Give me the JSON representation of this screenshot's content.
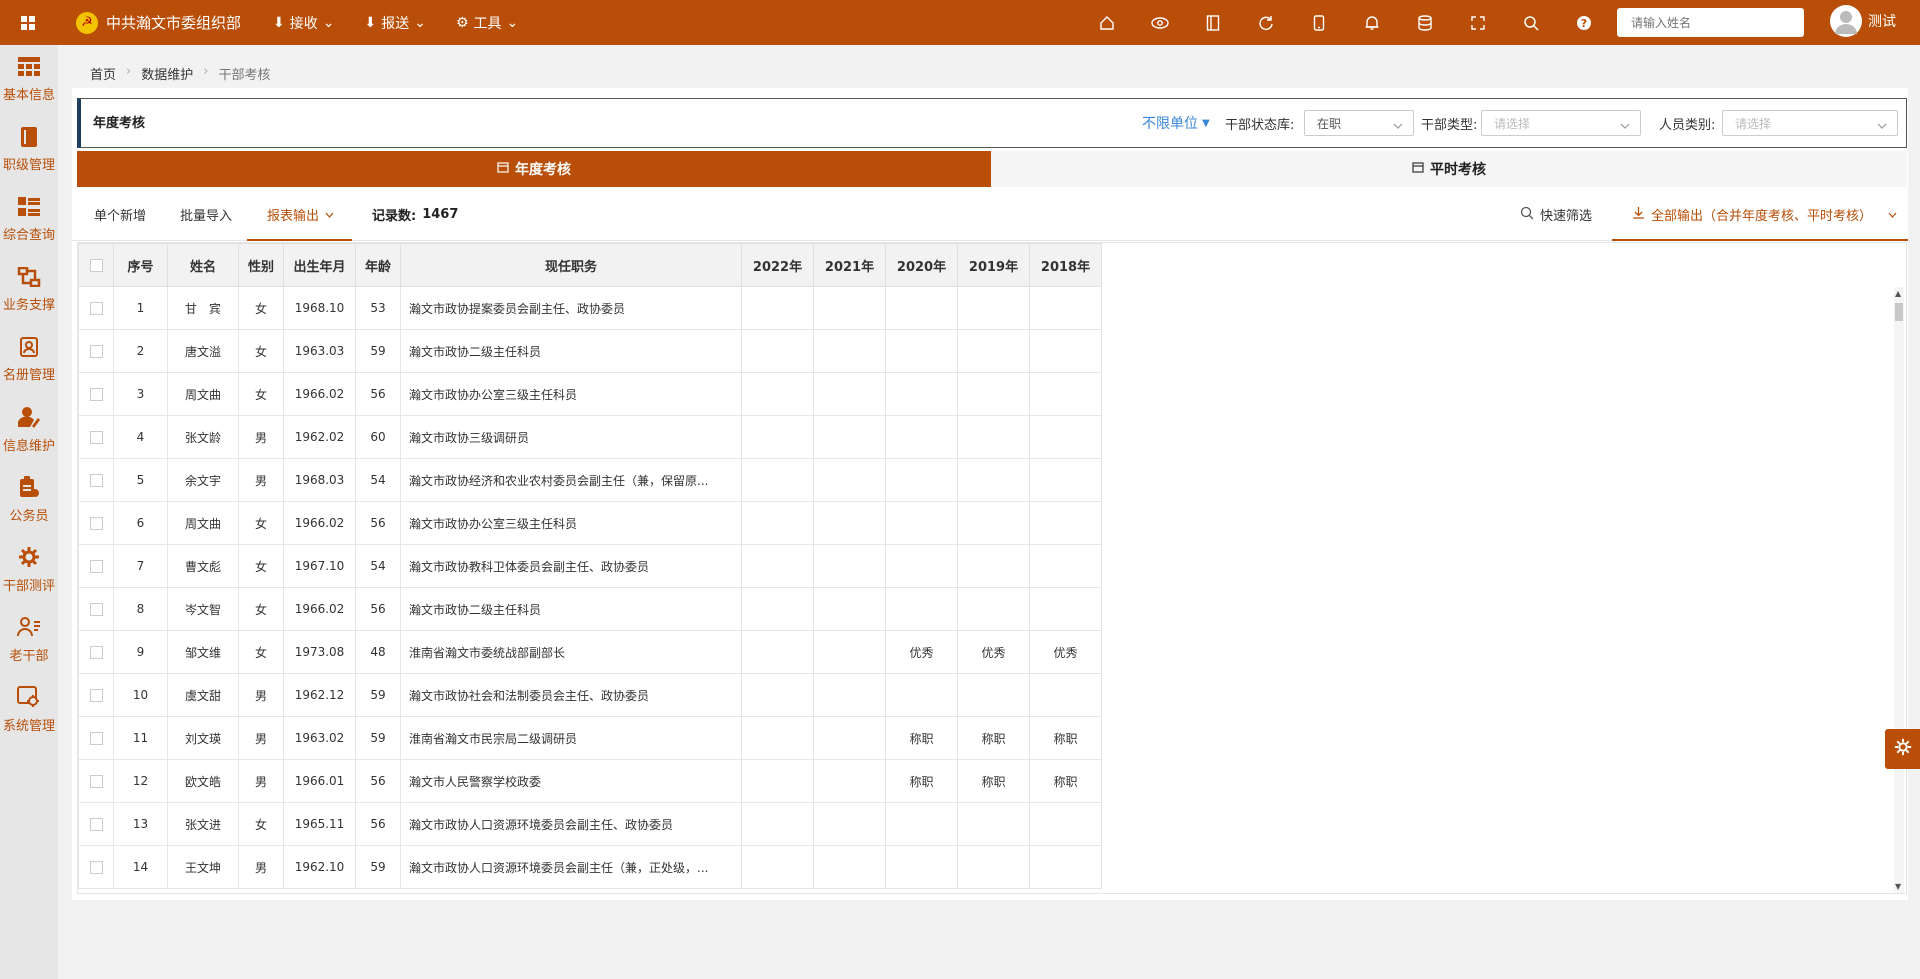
{
  "topbar": {
    "brand": "中共瀚文市委组织部",
    "menu": [
      {
        "label": "接收",
        "icon": "download-icon"
      },
      {
        "label": "报送",
        "icon": "upload-icon"
      },
      {
        "label": "工具",
        "icon": "gear-icon"
      }
    ],
    "search_placeholder": "请输入姓名",
    "user": "测试"
  },
  "sidebar": [
    {
      "label": "基本信息",
      "icon": "grid-icon"
    },
    {
      "label": "职级管理",
      "icon": "book-icon"
    },
    {
      "label": "综合查询",
      "icon": "list-icon"
    },
    {
      "label": "业务支撑",
      "icon": "flow-icon"
    },
    {
      "label": "名册管理",
      "icon": "roster-icon"
    },
    {
      "label": "信息维护",
      "icon": "user-edit-icon"
    },
    {
      "label": "公务员",
      "icon": "clipboard-icon"
    },
    {
      "label": "干部测评",
      "icon": "cog-icon"
    },
    {
      "label": "老干部",
      "icon": "elder-icon"
    },
    {
      "label": "系统管理",
      "icon": "settings-icon"
    }
  ],
  "breadcrumb": [
    "首页",
    "数据维护",
    "干部考核"
  ],
  "filter": {
    "title": "年度考核",
    "unit": "不限单位",
    "status_label": "干部状态库:",
    "status_value": "在职",
    "type_label": "干部类型:",
    "type_placeholder": "请选择",
    "category_label": "人员类别:",
    "category_placeholder": "请选择"
  },
  "tabs": [
    {
      "label": "年度考核"
    },
    {
      "label": "平时考核"
    }
  ],
  "toolbar": {
    "add": "单个新增",
    "import": "批量导入",
    "export": "报表输出",
    "count_label": "记录数:",
    "count": "1467",
    "quick_filter": "快速筛选",
    "export_all": "全部输出（合并年度考核、平时考核）"
  },
  "table": {
    "headers": [
      "序号",
      "姓名",
      "性别",
      "出生年月",
      "年龄",
      "现任职务",
      "2022年",
      "2021年",
      "2020年",
      "2019年",
      "2018年"
    ],
    "rows": [
      [
        "1",
        "甘　宾",
        "女",
        "1968.10",
        "53",
        "瀚文市政协提案委员会副主任、政协委员",
        "",
        "",
        "",
        "",
        ""
      ],
      [
        "2",
        "唐文溢",
        "女",
        "1963.03",
        "59",
        "瀚文市政协二级主任科员",
        "",
        "",
        "",
        "",
        ""
      ],
      [
        "3",
        "周文曲",
        "女",
        "1966.02",
        "56",
        "瀚文市政协办公室三级主任科员",
        "",
        "",
        "",
        "",
        ""
      ],
      [
        "4",
        "张文龄",
        "男",
        "1962.02",
        "60",
        "瀚文市政协三级调研员",
        "",
        "",
        "",
        "",
        ""
      ],
      [
        "5",
        "余文宇",
        "男",
        "1968.03",
        "54",
        "瀚文市政协经济和农业农村委员会副主任（兼，保留原...",
        "",
        "",
        "",
        "",
        ""
      ],
      [
        "6",
        "周文曲",
        "女",
        "1966.02",
        "56",
        "瀚文市政协办公室三级主任科员",
        "",
        "",
        "",
        "",
        ""
      ],
      [
        "7",
        "曹文彪",
        "女",
        "1967.10",
        "54",
        "瀚文市政协教科卫体委员会副主任、政协委员",
        "",
        "",
        "",
        "",
        ""
      ],
      [
        "8",
        "岑文智",
        "女",
        "1966.02",
        "56",
        "瀚文市政协二级主任科员",
        "",
        "",
        "",
        "",
        ""
      ],
      [
        "9",
        "邹文维",
        "女",
        "1973.08",
        "48",
        "淮南省瀚文市委统战部副部长",
        "",
        "",
        "优秀",
        "优秀",
        "优秀"
      ],
      [
        "10",
        "虞文甜",
        "男",
        "1962.12",
        "59",
        "瀚文市政协社会和法制委员会主任、政协委员",
        "",
        "",
        "",
        "",
        ""
      ],
      [
        "11",
        "刘文瑛",
        "男",
        "1963.02",
        "59",
        "淮南省瀚文市民宗局二级调研员",
        "",
        "",
        "称职",
        "称职",
        "称职"
      ],
      [
        "12",
        "欧文皓",
        "男",
        "1966.01",
        "56",
        "瀚文市人民警察学校政委",
        "",
        "",
        "称职",
        "称职",
        "称职"
      ],
      [
        "13",
        "张文进",
        "女",
        "1965.11",
        "56",
        "瀚文市政协人口资源环境委员会副主任、政协委员",
        "",
        "",
        "",
        "",
        ""
      ],
      [
        "14",
        "王文坤",
        "男",
        "1962.10",
        "59",
        "瀚文市政协人口资源环境委员会副主任（兼，正处级，...",
        "",
        "",
        "",
        "",
        ""
      ]
    ]
  },
  "colors": {
    "brand": "#b84e07",
    "link": "#3a87d8"
  }
}
